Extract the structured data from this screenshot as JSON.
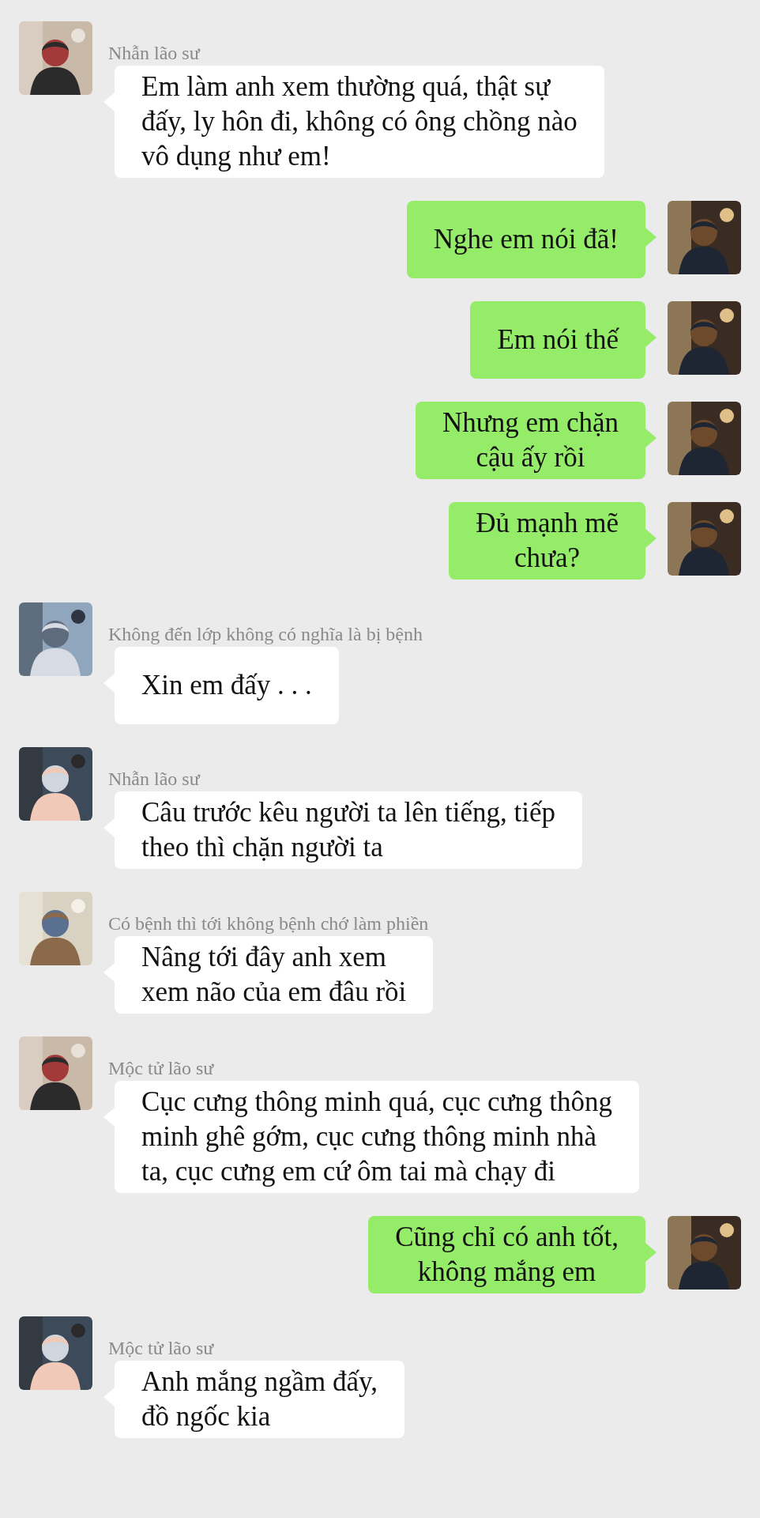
{
  "messages": [
    {
      "kind": "received",
      "sender": "Nhẫn lão sư",
      "lines": [
        "Em làm anh xem thường quá, thật sự",
        "đấy, ly hôn đi, không có ông chồng nào",
        "vô dụng như em!"
      ]
    },
    {
      "kind": "sent",
      "lines": [
        "Nghe em nói đã!"
      ]
    },
    {
      "kind": "sent",
      "lines": [
        "Em nói thế"
      ]
    },
    {
      "kind": "sent",
      "lines": [
        "Nhưng em chặn",
        "cậu ấy rồi"
      ]
    },
    {
      "kind": "sent",
      "lines": [
        "Đủ mạnh mẽ",
        "chưa?"
      ]
    },
    {
      "kind": "received",
      "sender": "Không đến lớp không có nghĩa là bị bệnh",
      "lines": [
        "Xin em đấy . . ."
      ]
    },
    {
      "kind": "received",
      "sender": "Nhẫn lão sư",
      "lines": [
        "Câu trước kêu người ta lên tiếng, tiếp",
        "theo thì chặn người ta"
      ]
    },
    {
      "kind": "received",
      "sender": "Có bệnh thì tới không bệnh chớ làm phiền",
      "lines": [
        "Nâng tới đây anh xem",
        "xem não của em đâu rồi"
      ]
    },
    {
      "kind": "received",
      "sender": "Mộc tử lão sư",
      "lines": [
        "Cục cưng thông minh quá, cục cưng thông",
        "minh ghê gớm, cục cưng thông minh nhà",
        "ta, cục cưng em cứ ôm tai mà chạy đi"
      ]
    },
    {
      "kind": "sent",
      "lines": [
        "Cũng chỉ có anh tốt,",
        "không mắng em"
      ]
    },
    {
      "kind": "received",
      "sender": "Mộc tử lão sư",
      "lines": [
        "Anh mắng ngầm đấy,",
        "đồ ngốc kia"
      ]
    }
  ]
}
